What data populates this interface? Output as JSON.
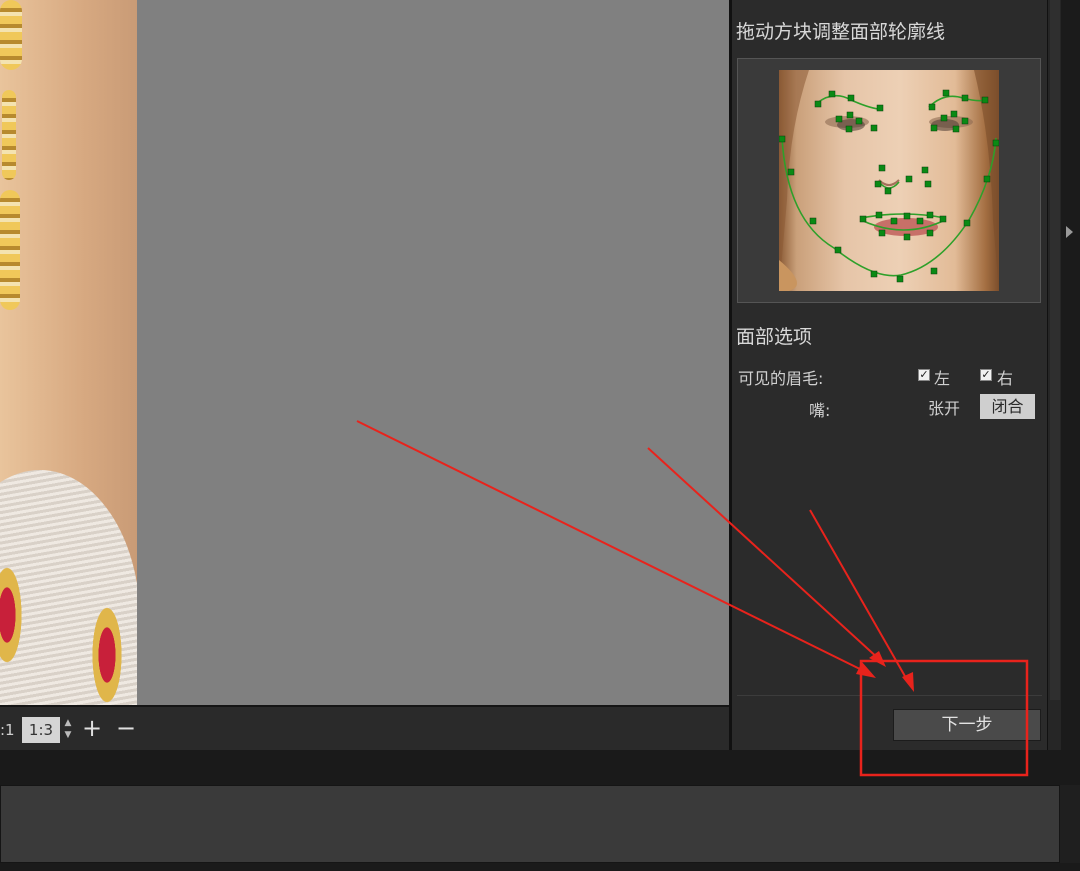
{
  "panel": {
    "title": "拖动方块调整面部轮廓线",
    "face_options_title": "面部选项",
    "eyebrows_label": "可见的眉毛:",
    "eyebrow_left": "左",
    "eyebrow_right": "右",
    "eyebrow_left_checked": true,
    "eyebrow_right_checked": true,
    "mouth_label": "嘴:",
    "mouth_open": "张开",
    "mouth_closed": "闭合",
    "next_button": "下一步"
  },
  "toolbar": {
    "zoom_prev": ":1",
    "zoom_value": "1:3",
    "zoom_in": "+",
    "zoom_out": "−"
  },
  "colors": {
    "annotation": "#e8231c",
    "landmark": "#0a8a14",
    "canvas": "#808080",
    "panel": "#2b2b2b"
  }
}
